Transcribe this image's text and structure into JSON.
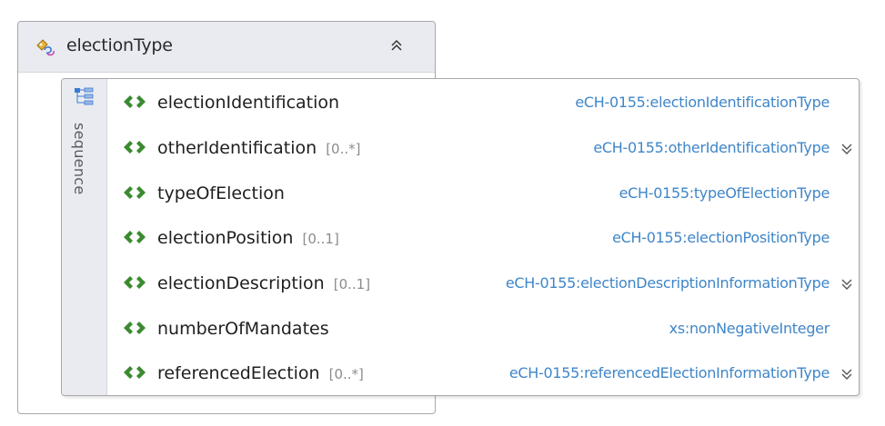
{
  "complex_type": {
    "name": "electionType",
    "icon": "complex-type-icon",
    "collapse_icon": "chevron-double-up-icon"
  },
  "sequence": {
    "label": "sequence",
    "icon": "sequence-icon",
    "elements": [
      {
        "name": "electionIdentification",
        "cardinality": "",
        "type": "eCH-0155:electionIdentificationType",
        "expandable": false
      },
      {
        "name": "otherIdentification",
        "cardinality": "[0..*]",
        "type": "eCH-0155:otherIdentificationType",
        "expandable": true
      },
      {
        "name": "typeOfElection",
        "cardinality": "",
        "type": "eCH-0155:typeOfElectionType",
        "expandable": false
      },
      {
        "name": "electionPosition",
        "cardinality": "[0..1]",
        "type": "eCH-0155:electionPositionType",
        "expandable": false
      },
      {
        "name": "electionDescription",
        "cardinality": "[0..1]",
        "type": "eCH-0155:electionDescriptionInformationType",
        "expandable": true
      },
      {
        "name": "numberOfMandates",
        "cardinality": "",
        "type": "xs:nonNegativeInteger",
        "expandable": false
      },
      {
        "name": "referencedElection",
        "cardinality": "[0..*]",
        "type": "eCH-0155:referencedElectionInformationType",
        "expandable": true
      }
    ]
  },
  "colors": {
    "type_text": "#3f86c8",
    "element_icon": "#3b8a30",
    "header_bg": "#e9ebf0"
  }
}
